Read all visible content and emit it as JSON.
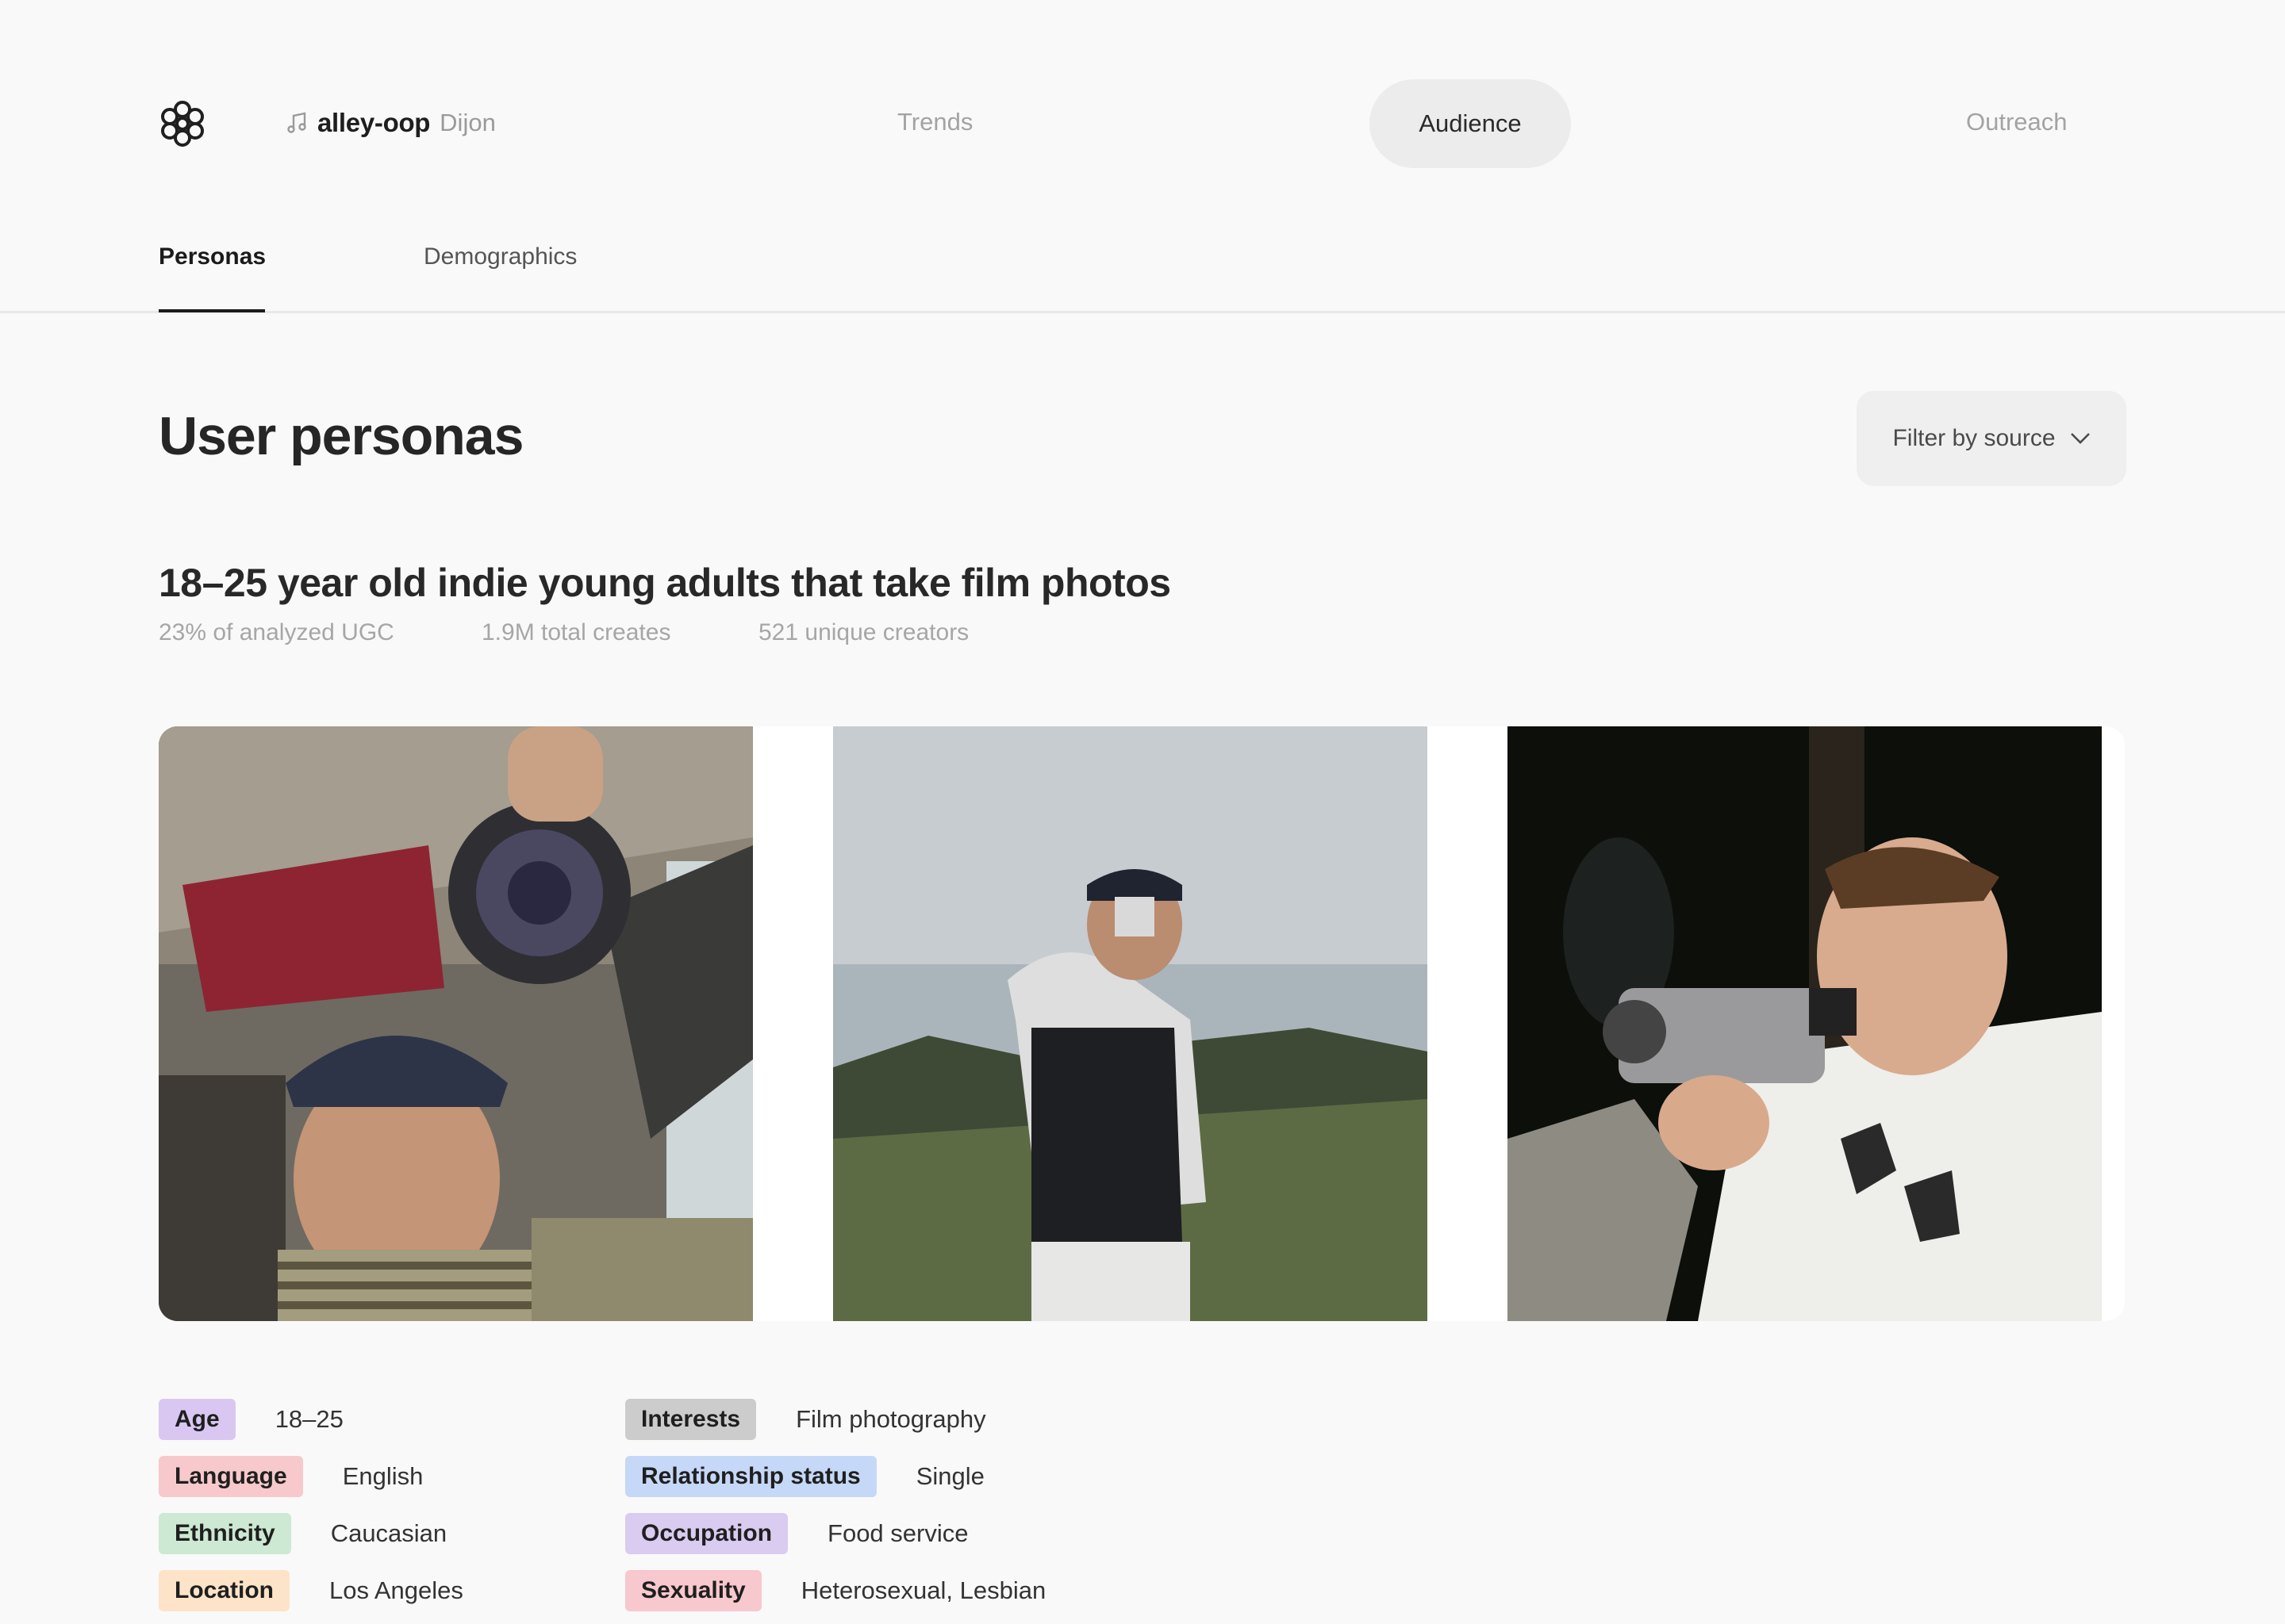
{
  "nav": {
    "project_name": "alley-oop",
    "artist": "Dijon",
    "links": [
      "Trends",
      "Audience",
      "Outreach"
    ],
    "active": "Audience"
  },
  "subtabs": [
    "Personas",
    "Demographics"
  ],
  "page_title": "User personas",
  "filter_label": "Filter by source",
  "persona": {
    "title": "18–25 year old indie young adults that take film photos",
    "stats": [
      "23% of analyzed UGC",
      "1.9M total creates",
      "521 unique creators"
    ],
    "attributes_left": [
      {
        "label": "Age",
        "value": "18–25",
        "color": "#d9c7f2"
      },
      {
        "label": "Language",
        "value": "English",
        "color": "#f7c9cc"
      },
      {
        "label": "Ethnicity",
        "value": "Caucasian",
        "color": "#cde8d3"
      },
      {
        "label": "Location",
        "value": "Los Angeles",
        "color": "#fde3c8"
      }
    ],
    "attributes_right": [
      {
        "label": "Interests",
        "value": "Film photography",
        "color": "#cccccc"
      },
      {
        "label": "Relationship status",
        "value": "Single",
        "color": "#c6d8f7"
      },
      {
        "label": "Occupation",
        "value": "Food service",
        "color": "#dacbf1"
      },
      {
        "label": "Sexuality",
        "value": "Heterosexual, Lesbian",
        "color": "#f7c8cd"
      }
    ]
  }
}
